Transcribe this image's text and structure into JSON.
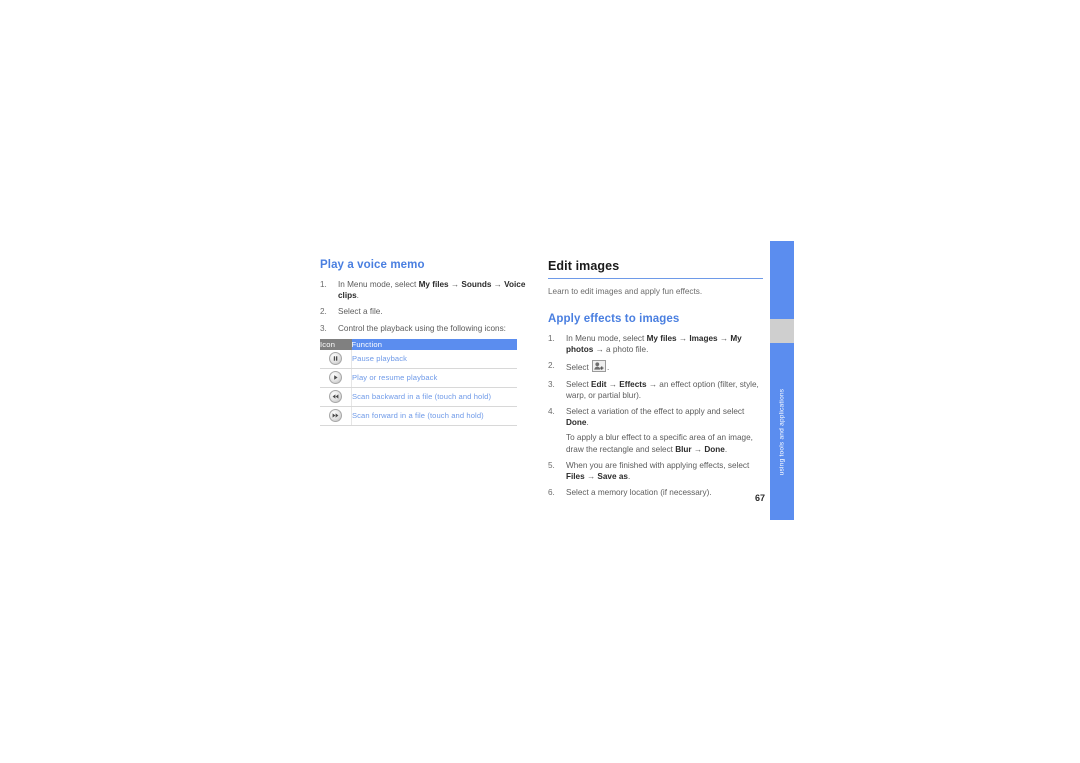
{
  "page_number": "67",
  "side_tab": {
    "section_label": "using tools and applications",
    "tab_color": "#5b8def",
    "current_marker_color": "#cfcfcf"
  },
  "left_column": {
    "heading": "Play a voice memo",
    "heading_color": "#4a7fe0",
    "steps": [
      {
        "num": "1.",
        "parts": [
          {
            "t": "In Menu mode, select ",
            "b": false
          },
          {
            "t": "My files",
            "b": true
          },
          {
            "t": " → ",
            "b": false
          },
          {
            "t": "Sounds",
            "b": true
          },
          {
            "t": " → ",
            "b": false
          },
          {
            "t": "Voice clips",
            "b": true
          },
          {
            "t": ".",
            "b": false
          }
        ]
      },
      {
        "num": "2.",
        "parts": [
          {
            "t": "Select a file.",
            "b": false
          }
        ]
      },
      {
        "num": "3.",
        "parts": [
          {
            "t": "Control the playback using the following icons:",
            "b": false
          }
        ]
      }
    ],
    "table": {
      "headers": [
        "Icon",
        "Function"
      ],
      "header_icon_bg": "#808080",
      "header_func_bg": "#5b8def",
      "rows": [
        {
          "icon": "pause-icon",
          "function": "Pause playback"
        },
        {
          "icon": "play-icon",
          "function": "Play or resume playback"
        },
        {
          "icon": "rewind-icon",
          "function": "Scan backward in a file (touch and hold)"
        },
        {
          "icon": "fast-forward-icon",
          "function": "Scan forward in a file (touch and hold)"
        }
      ]
    }
  },
  "right_column": {
    "heading": "Edit images",
    "intro": "Learn to edit images and apply fun effects.",
    "subheading": "Apply effects to images",
    "subheading_color": "#4a7fe0",
    "steps": [
      {
        "num": "1.",
        "parts": [
          {
            "t": "In Menu mode, select ",
            "b": false
          },
          {
            "t": "My files",
            "b": true
          },
          {
            "t": " → ",
            "b": false
          },
          {
            "t": "Images",
            "b": true
          },
          {
            "t": " → ",
            "b": false
          },
          {
            "t": "My photos",
            "b": true
          },
          {
            "t": " → a photo file.",
            "b": false
          }
        ]
      },
      {
        "num": "2.",
        "parts": [
          {
            "t": "Select ",
            "b": false
          },
          {
            "t": "[edit-tool-icon]",
            "b": false,
            "icon": true
          },
          {
            "t": ".",
            "b": false
          }
        ]
      },
      {
        "num": "3.",
        "parts": [
          {
            "t": "Select ",
            "b": false
          },
          {
            "t": "Edit",
            "b": true
          },
          {
            "t": " → ",
            "b": false
          },
          {
            "t": "Effects",
            "b": true
          },
          {
            "t": " → an effect option (filter, style, warp, or partial blur).",
            "b": false
          }
        ]
      },
      {
        "num": "4.",
        "parts": [
          {
            "t": "Select a variation of the effect to apply and select ",
            "b": false
          },
          {
            "t": "Done",
            "b": true
          },
          {
            "t": ".",
            "b": false
          }
        ],
        "sub_parts": [
          {
            "t": "To apply a blur effect to a specific area of an image, draw the rectangle and select ",
            "b": false
          },
          {
            "t": "Blur",
            "b": true
          },
          {
            "t": " → ",
            "b": false
          },
          {
            "t": "Done",
            "b": true
          },
          {
            "t": ".",
            "b": false
          }
        ]
      },
      {
        "num": "5.",
        "parts": [
          {
            "t": "When you are finished with applying effects, select ",
            "b": false
          },
          {
            "t": "Files",
            "b": true
          },
          {
            "t": " → ",
            "b": false
          },
          {
            "t": "Save as",
            "b": true
          },
          {
            "t": ".",
            "b": false
          }
        ]
      },
      {
        "num": "6.",
        "parts": [
          {
            "t": "Select a memory location (if necessary).",
            "b": false
          }
        ]
      }
    ]
  }
}
